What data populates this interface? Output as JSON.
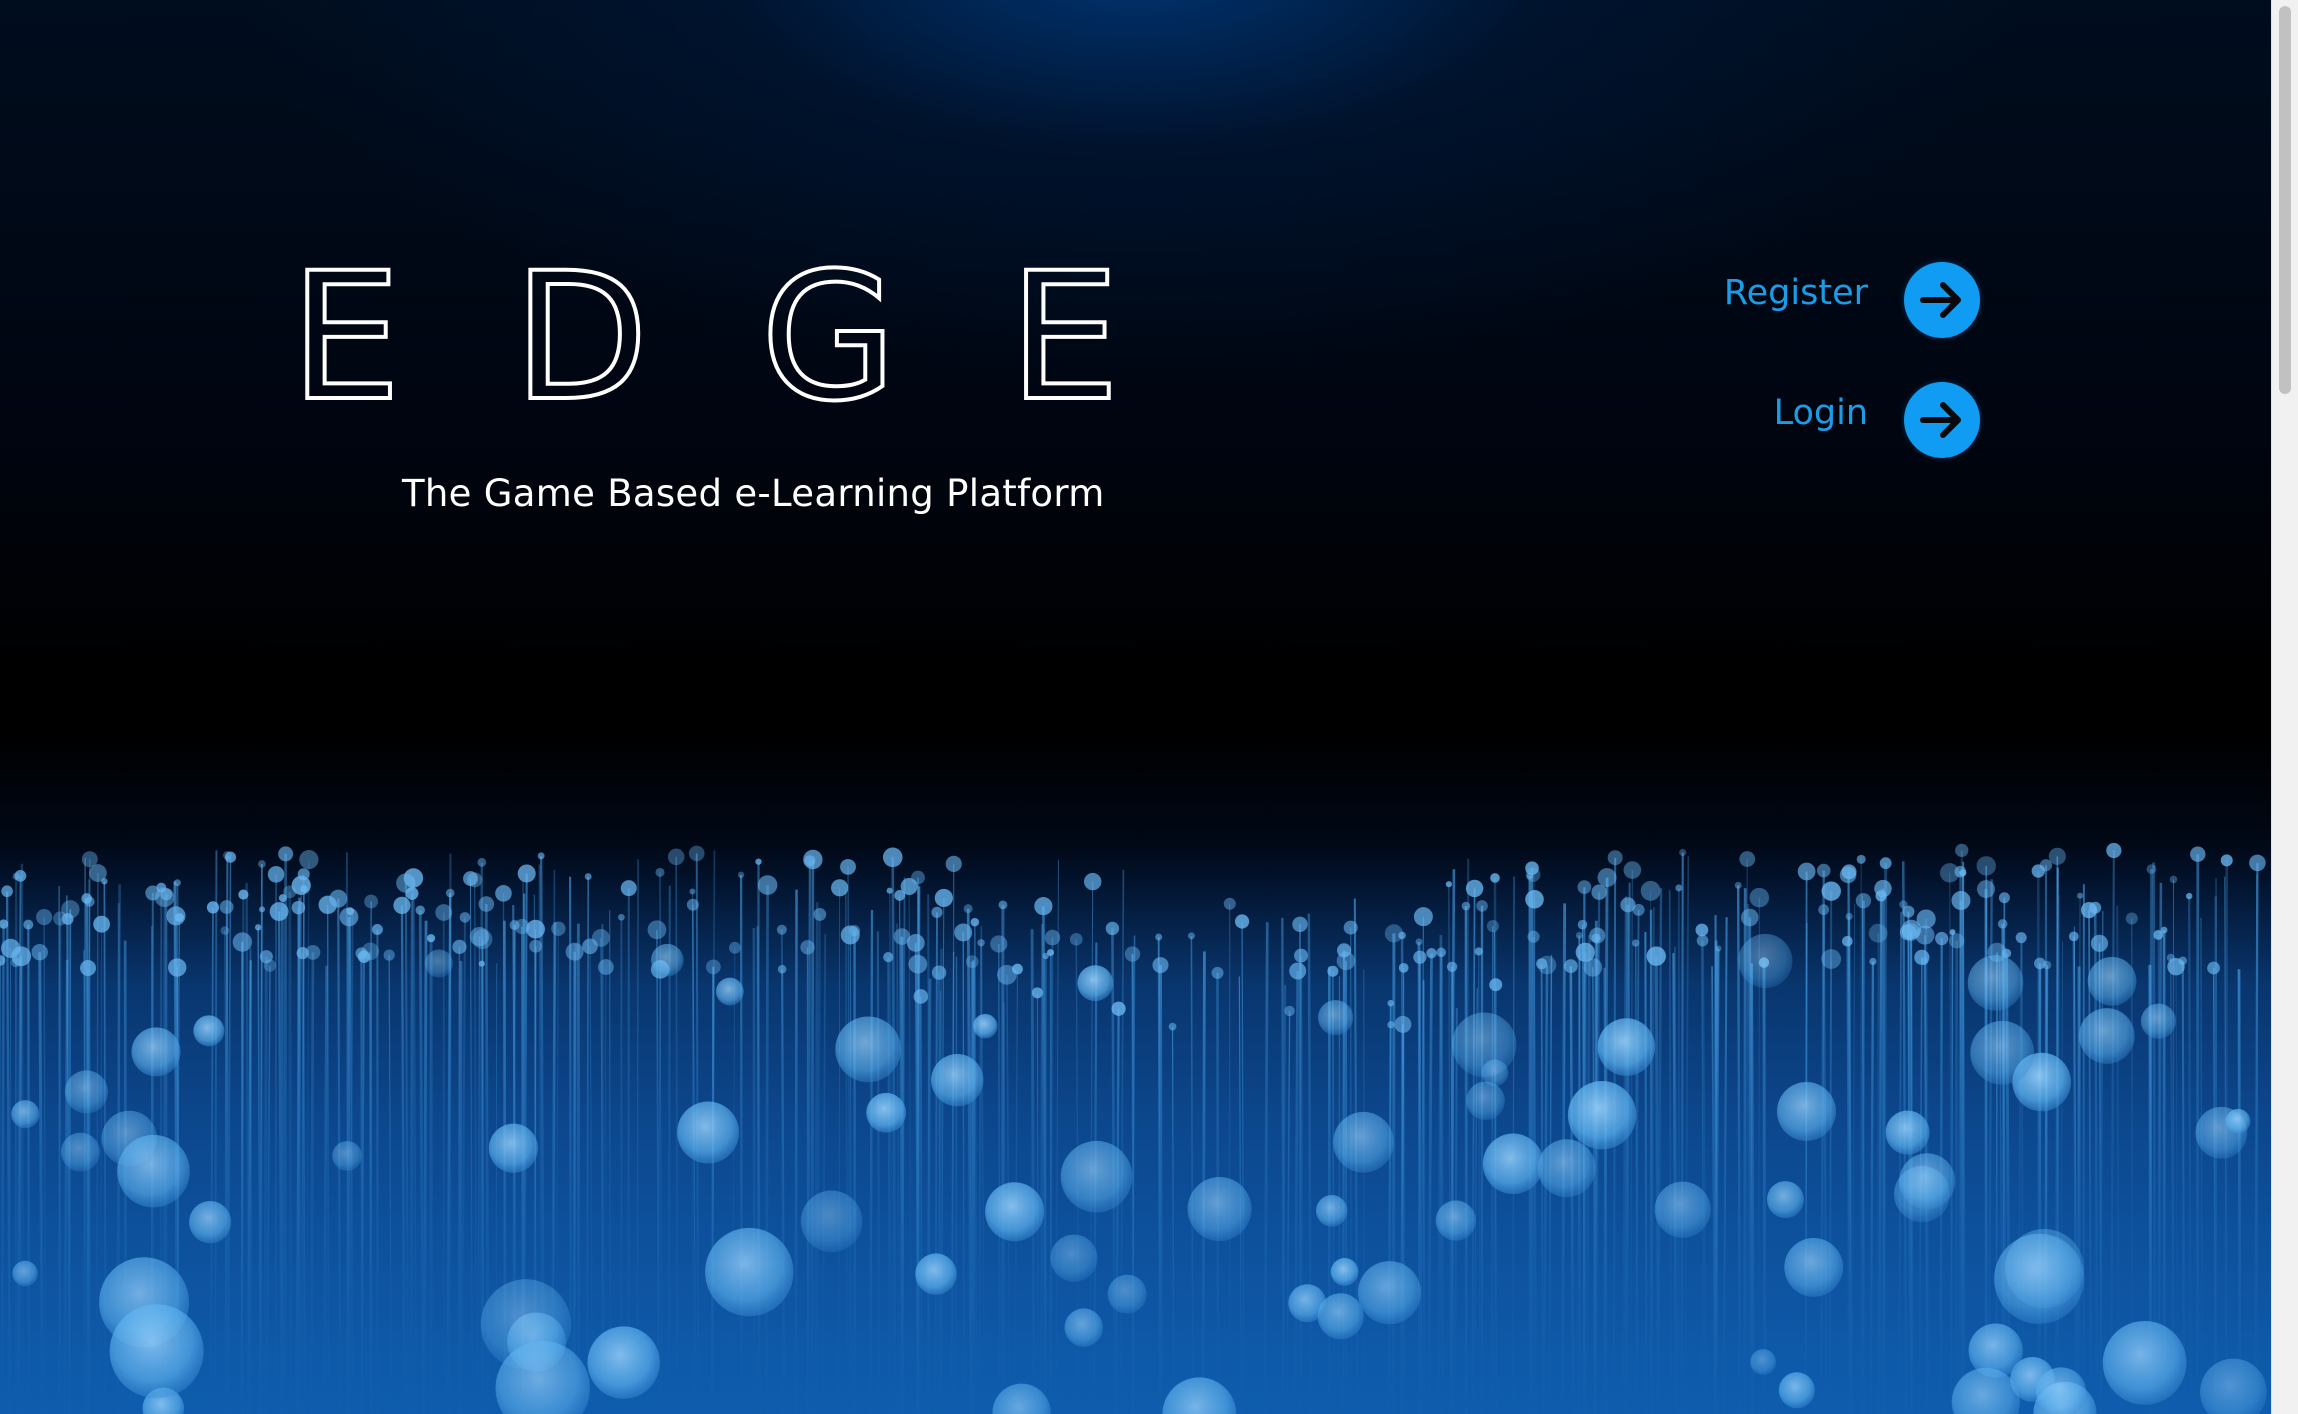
{
  "hero": {
    "logo_letters": [
      "E",
      "D",
      "G",
      "E"
    ],
    "tagline": "The Game Based e-Learning Platform"
  },
  "auth": {
    "register_label": "Register",
    "login_label": "Login",
    "arrow_icon": "arrow-right-icon"
  },
  "colors": {
    "accent": "#1a9de6",
    "button": "#109cf2",
    "logo": "#ffffff"
  }
}
